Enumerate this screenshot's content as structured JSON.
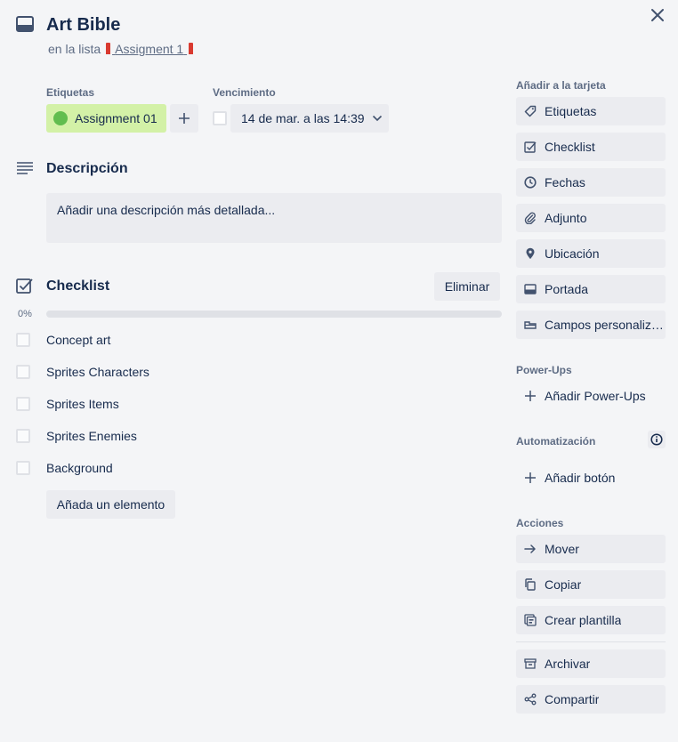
{
  "card": {
    "title": "Art Bible",
    "in_list_prefix": "en la lista",
    "list_name": "Assigment 1"
  },
  "labels": {
    "heading": "Etiquetas",
    "items": [
      {
        "name": "Assignment 01",
        "color": "#61bd4f",
        "bg": "#d3f1a7"
      }
    ]
  },
  "due": {
    "heading": "Vencimiento",
    "value": "14 de mar. a las 14:39"
  },
  "description": {
    "heading": "Descripción",
    "placeholder": "Añadir una descripción más detallada..."
  },
  "checklist": {
    "heading": "Checklist",
    "delete_label": "Eliminar",
    "progress_label": "0%",
    "progress": 0,
    "items": [
      {
        "text": "Concept art",
        "checked": false
      },
      {
        "text": "Sprites Characters",
        "checked": false
      },
      {
        "text": "Sprites Items",
        "checked": false
      },
      {
        "text": "Sprites Enemies",
        "checked": false
      },
      {
        "text": "Background",
        "checked": false
      }
    ],
    "add_item_label": "Añada un elemento"
  },
  "sidebar": {
    "add_to_card_heading": "Añadir a la tarjeta",
    "add_to_card": [
      {
        "label": "Etiquetas",
        "icon": "tag-icon"
      },
      {
        "label": "Checklist",
        "icon": "checkbox-icon"
      },
      {
        "label": "Fechas",
        "icon": "clock-icon"
      },
      {
        "label": "Adjunto",
        "icon": "paperclip-icon"
      },
      {
        "label": "Ubicación",
        "icon": "location-pin-icon"
      },
      {
        "label": "Portada",
        "icon": "cover-icon"
      },
      {
        "label": "Campos personaliza...",
        "icon": "custom-fields-icon"
      }
    ],
    "powerups_heading": "Power-Ups",
    "add_powerups_label": "Añadir Power-Ups",
    "automation_heading": "Automatización",
    "add_button_label": "Añadir botón",
    "actions_heading": "Acciones",
    "actions": [
      {
        "label": "Mover",
        "icon": "arrow-right-icon"
      },
      {
        "label": "Copiar",
        "icon": "copy-icon"
      },
      {
        "label": "Crear plantilla",
        "icon": "template-icon"
      }
    ],
    "actions_secondary": [
      {
        "label": "Archivar",
        "icon": "archive-icon"
      },
      {
        "label": "Compartir",
        "icon": "share-icon"
      }
    ]
  }
}
